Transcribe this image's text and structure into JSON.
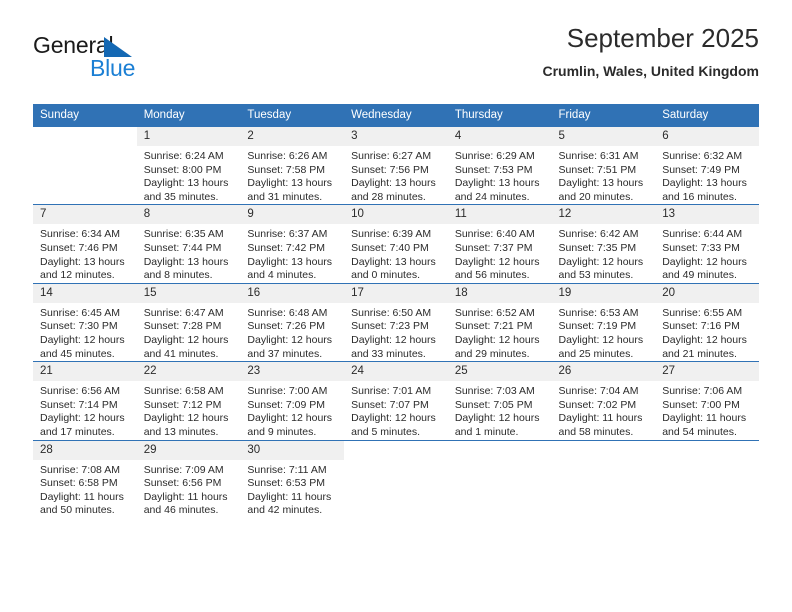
{
  "logo": {
    "word_top": "General",
    "word_bottom": "Blue",
    "triangle_color": "#1468b3",
    "blue_color": "#1b7fd4"
  },
  "header": {
    "title": "September 2025",
    "subtitle": "Crumlin, Wales, United Kingdom"
  },
  "theme": {
    "header_row_bg": "#3072b5",
    "daynum_bg": "#f0f0f0",
    "text_color": "#2b2b2b"
  },
  "calendar": {
    "weekday_headers": [
      "Sunday",
      "Monday",
      "Tuesday",
      "Wednesday",
      "Thursday",
      "Friday",
      "Saturday"
    ],
    "weeks": [
      [
        {
          "day": "",
          "empty": true
        },
        {
          "day": "1",
          "sunrise": "Sunrise: 6:24 AM",
          "sunset": "Sunset: 8:00 PM",
          "daylight1": "Daylight: 13 hours",
          "daylight2": "and 35 minutes."
        },
        {
          "day": "2",
          "sunrise": "Sunrise: 6:26 AM",
          "sunset": "Sunset: 7:58 PM",
          "daylight1": "Daylight: 13 hours",
          "daylight2": "and 31 minutes."
        },
        {
          "day": "3",
          "sunrise": "Sunrise: 6:27 AM",
          "sunset": "Sunset: 7:56 PM",
          "daylight1": "Daylight: 13 hours",
          "daylight2": "and 28 minutes."
        },
        {
          "day": "4",
          "sunrise": "Sunrise: 6:29 AM",
          "sunset": "Sunset: 7:53 PM",
          "daylight1": "Daylight: 13 hours",
          "daylight2": "and 24 minutes."
        },
        {
          "day": "5",
          "sunrise": "Sunrise: 6:31 AM",
          "sunset": "Sunset: 7:51 PM",
          "daylight1": "Daylight: 13 hours",
          "daylight2": "and 20 minutes."
        },
        {
          "day": "6",
          "sunrise": "Sunrise: 6:32 AM",
          "sunset": "Sunset: 7:49 PM",
          "daylight1": "Daylight: 13 hours",
          "daylight2": "and 16 minutes."
        }
      ],
      [
        {
          "day": "7",
          "sunrise": "Sunrise: 6:34 AM",
          "sunset": "Sunset: 7:46 PM",
          "daylight1": "Daylight: 13 hours",
          "daylight2": "and 12 minutes."
        },
        {
          "day": "8",
          "sunrise": "Sunrise: 6:35 AM",
          "sunset": "Sunset: 7:44 PM",
          "daylight1": "Daylight: 13 hours",
          "daylight2": "and 8 minutes."
        },
        {
          "day": "9",
          "sunrise": "Sunrise: 6:37 AM",
          "sunset": "Sunset: 7:42 PM",
          "daylight1": "Daylight: 13 hours",
          "daylight2": "and 4 minutes."
        },
        {
          "day": "10",
          "sunrise": "Sunrise: 6:39 AM",
          "sunset": "Sunset: 7:40 PM",
          "daylight1": "Daylight: 13 hours",
          "daylight2": "and 0 minutes."
        },
        {
          "day": "11",
          "sunrise": "Sunrise: 6:40 AM",
          "sunset": "Sunset: 7:37 PM",
          "daylight1": "Daylight: 12 hours",
          "daylight2": "and 56 minutes."
        },
        {
          "day": "12",
          "sunrise": "Sunrise: 6:42 AM",
          "sunset": "Sunset: 7:35 PM",
          "daylight1": "Daylight: 12 hours",
          "daylight2": "and 53 minutes."
        },
        {
          "day": "13",
          "sunrise": "Sunrise: 6:44 AM",
          "sunset": "Sunset: 7:33 PM",
          "daylight1": "Daylight: 12 hours",
          "daylight2": "and 49 minutes."
        }
      ],
      [
        {
          "day": "14",
          "sunrise": "Sunrise: 6:45 AM",
          "sunset": "Sunset: 7:30 PM",
          "daylight1": "Daylight: 12 hours",
          "daylight2": "and 45 minutes."
        },
        {
          "day": "15",
          "sunrise": "Sunrise: 6:47 AM",
          "sunset": "Sunset: 7:28 PM",
          "daylight1": "Daylight: 12 hours",
          "daylight2": "and 41 minutes."
        },
        {
          "day": "16",
          "sunrise": "Sunrise: 6:48 AM",
          "sunset": "Sunset: 7:26 PM",
          "daylight1": "Daylight: 12 hours",
          "daylight2": "and 37 minutes."
        },
        {
          "day": "17",
          "sunrise": "Sunrise: 6:50 AM",
          "sunset": "Sunset: 7:23 PM",
          "daylight1": "Daylight: 12 hours",
          "daylight2": "and 33 minutes."
        },
        {
          "day": "18",
          "sunrise": "Sunrise: 6:52 AM",
          "sunset": "Sunset: 7:21 PM",
          "daylight1": "Daylight: 12 hours",
          "daylight2": "and 29 minutes."
        },
        {
          "day": "19",
          "sunrise": "Sunrise: 6:53 AM",
          "sunset": "Sunset: 7:19 PM",
          "daylight1": "Daylight: 12 hours",
          "daylight2": "and 25 minutes."
        },
        {
          "day": "20",
          "sunrise": "Sunrise: 6:55 AM",
          "sunset": "Sunset: 7:16 PM",
          "daylight1": "Daylight: 12 hours",
          "daylight2": "and 21 minutes."
        }
      ],
      [
        {
          "day": "21",
          "sunrise": "Sunrise: 6:56 AM",
          "sunset": "Sunset: 7:14 PM",
          "daylight1": "Daylight: 12 hours",
          "daylight2": "and 17 minutes."
        },
        {
          "day": "22",
          "sunrise": "Sunrise: 6:58 AM",
          "sunset": "Sunset: 7:12 PM",
          "daylight1": "Daylight: 12 hours",
          "daylight2": "and 13 minutes."
        },
        {
          "day": "23",
          "sunrise": "Sunrise: 7:00 AM",
          "sunset": "Sunset: 7:09 PM",
          "daylight1": "Daylight: 12 hours",
          "daylight2": "and 9 minutes."
        },
        {
          "day": "24",
          "sunrise": "Sunrise: 7:01 AM",
          "sunset": "Sunset: 7:07 PM",
          "daylight1": "Daylight: 12 hours",
          "daylight2": "and 5 minutes."
        },
        {
          "day": "25",
          "sunrise": "Sunrise: 7:03 AM",
          "sunset": "Sunset: 7:05 PM",
          "daylight1": "Daylight: 12 hours",
          "daylight2": "and 1 minute."
        },
        {
          "day": "26",
          "sunrise": "Sunrise: 7:04 AM",
          "sunset": "Sunset: 7:02 PM",
          "daylight1": "Daylight: 11 hours",
          "daylight2": "and 58 minutes."
        },
        {
          "day": "27",
          "sunrise": "Sunrise: 7:06 AM",
          "sunset": "Sunset: 7:00 PM",
          "daylight1": "Daylight: 11 hours",
          "daylight2": "and 54 minutes."
        }
      ],
      [
        {
          "day": "28",
          "sunrise": "Sunrise: 7:08 AM",
          "sunset": "Sunset: 6:58 PM",
          "daylight1": "Daylight: 11 hours",
          "daylight2": "and 50 minutes."
        },
        {
          "day": "29",
          "sunrise": "Sunrise: 7:09 AM",
          "sunset": "Sunset: 6:56 PM",
          "daylight1": "Daylight: 11 hours",
          "daylight2": "and 46 minutes."
        },
        {
          "day": "30",
          "sunrise": "Sunrise: 7:11 AM",
          "sunset": "Sunset: 6:53 PM",
          "daylight1": "Daylight: 11 hours",
          "daylight2": "and 42 minutes."
        },
        {
          "day": "",
          "empty": true
        },
        {
          "day": "",
          "empty": true
        },
        {
          "day": "",
          "empty": true
        },
        {
          "day": "",
          "empty": true
        }
      ]
    ]
  }
}
